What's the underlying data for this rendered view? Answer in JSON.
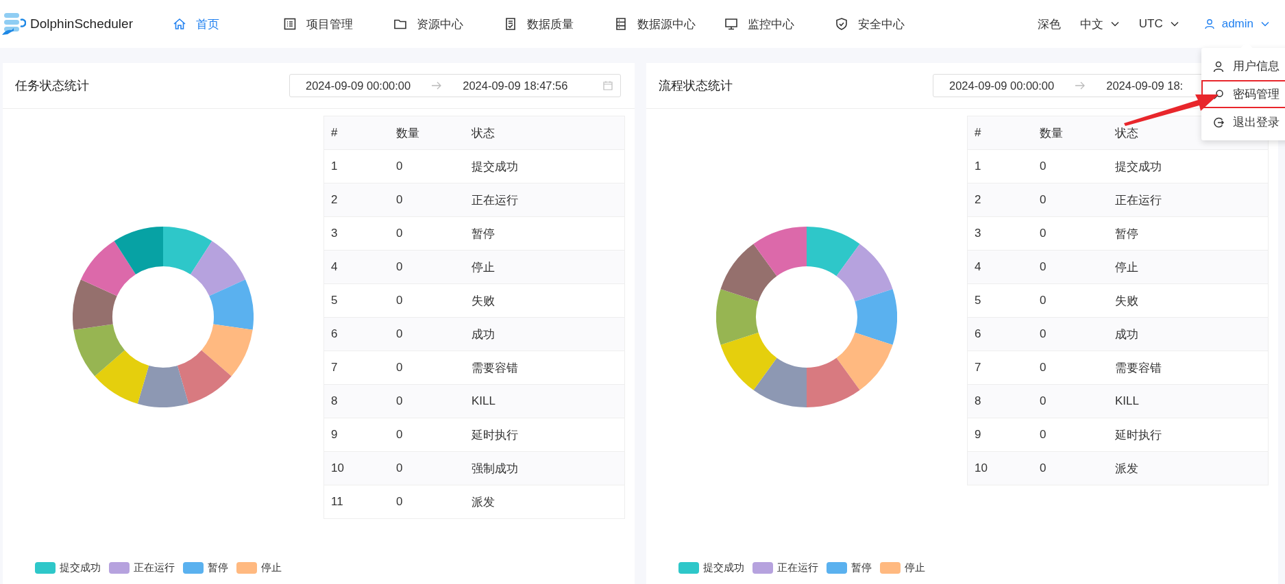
{
  "header": {
    "logo_text": "DolphinScheduler",
    "nav": [
      {
        "label": "首页",
        "selected": true
      },
      {
        "label": "项目管理",
        "selected": false
      },
      {
        "label": "资源中心",
        "selected": false
      },
      {
        "label": "数据质量",
        "selected": false
      },
      {
        "label": "数据源中心",
        "selected": false
      },
      {
        "label": "监控中心",
        "selected": false
      },
      {
        "label": "安全中心",
        "selected": false
      }
    ],
    "theme": "深色",
    "language": "中文",
    "timezone": "UTC",
    "user": "admin"
  },
  "user_menu": {
    "open": true,
    "items": [
      {
        "label": "用户信息",
        "highlighted": false
      },
      {
        "label": "密码管理",
        "highlighted": true
      },
      {
        "label": "退出登录",
        "highlighted": false
      }
    ]
  },
  "panels": [
    {
      "title": "任务状态统计",
      "date_start": "2024-09-09 00:00:00",
      "date_end": "2024-09-09 18:47:56",
      "calendar_icon": true,
      "table": {
        "columns": [
          "#",
          "数量",
          "状态"
        ],
        "rows": [
          [
            "1",
            "0",
            "提交成功"
          ],
          [
            "2",
            "0",
            "正在运行"
          ],
          [
            "3",
            "0",
            "暂停"
          ],
          [
            "4",
            "0",
            "停止"
          ],
          [
            "5",
            "0",
            "失败"
          ],
          [
            "6",
            "0",
            "成功"
          ],
          [
            "7",
            "0",
            "需要容错"
          ],
          [
            "8",
            "0",
            "KILL"
          ],
          [
            "9",
            "0",
            "延时执行"
          ],
          [
            "10",
            "0",
            "强制成功"
          ],
          [
            "11",
            "0",
            "派发"
          ]
        ]
      },
      "donut": {
        "slices": [
          {
            "color": "#2ec7c9"
          },
          {
            "color": "#b6a2de"
          },
          {
            "color": "#5ab1ef"
          },
          {
            "color": "#ffb980"
          },
          {
            "color": "#d87a80"
          },
          {
            "color": "#8d98b3"
          },
          {
            "color": "#e5cf0d"
          },
          {
            "color": "#97b552"
          },
          {
            "color": "#95706d"
          },
          {
            "color": "#dc69aa"
          },
          {
            "color": "#07a2a4"
          }
        ]
      },
      "legend": [
        {
          "label": "提交成功",
          "color": "#2ec7c9"
        },
        {
          "label": "正在运行",
          "color": "#b6a2de"
        },
        {
          "label": "暂停",
          "color": "#5ab1ef"
        },
        {
          "label": "停止",
          "color": "#ffb980"
        }
      ]
    },
    {
      "title": "流程状态统计",
      "date_start": "2024-09-09 00:00:00",
      "date_end": "2024-09-09 18:",
      "table": {
        "columns": [
          "#",
          "数量",
          "状态"
        ],
        "rows": [
          [
            "1",
            "0",
            "提交成功"
          ],
          [
            "2",
            "0",
            "正在运行"
          ],
          [
            "3",
            "0",
            "暂停"
          ],
          [
            "4",
            "0",
            "停止"
          ],
          [
            "5",
            "0",
            "失败"
          ],
          [
            "6",
            "0",
            "成功"
          ],
          [
            "7",
            "0",
            "需要容错"
          ],
          [
            "8",
            "0",
            "KILL"
          ],
          [
            "9",
            "0",
            "延时执行"
          ],
          [
            "10",
            "0",
            "派发"
          ]
        ]
      },
      "donut": {
        "slices": [
          {
            "color": "#2ec7c9"
          },
          {
            "color": "#b6a2de"
          },
          {
            "color": "#5ab1ef"
          },
          {
            "color": "#ffb980"
          },
          {
            "color": "#d87a80"
          },
          {
            "color": "#8d98b3"
          },
          {
            "color": "#e5cf0d"
          },
          {
            "color": "#97b552"
          },
          {
            "color": "#95706d"
          },
          {
            "color": "#dc69aa"
          }
        ]
      },
      "legend": [
        {
          "label": "提交成功",
          "color": "#2ec7c9"
        },
        {
          "label": "正在运行",
          "color": "#b6a2de"
        },
        {
          "label": "暂停",
          "color": "#5ab1ef"
        },
        {
          "label": "停止",
          "color": "#ffb980"
        }
      ]
    }
  ]
}
